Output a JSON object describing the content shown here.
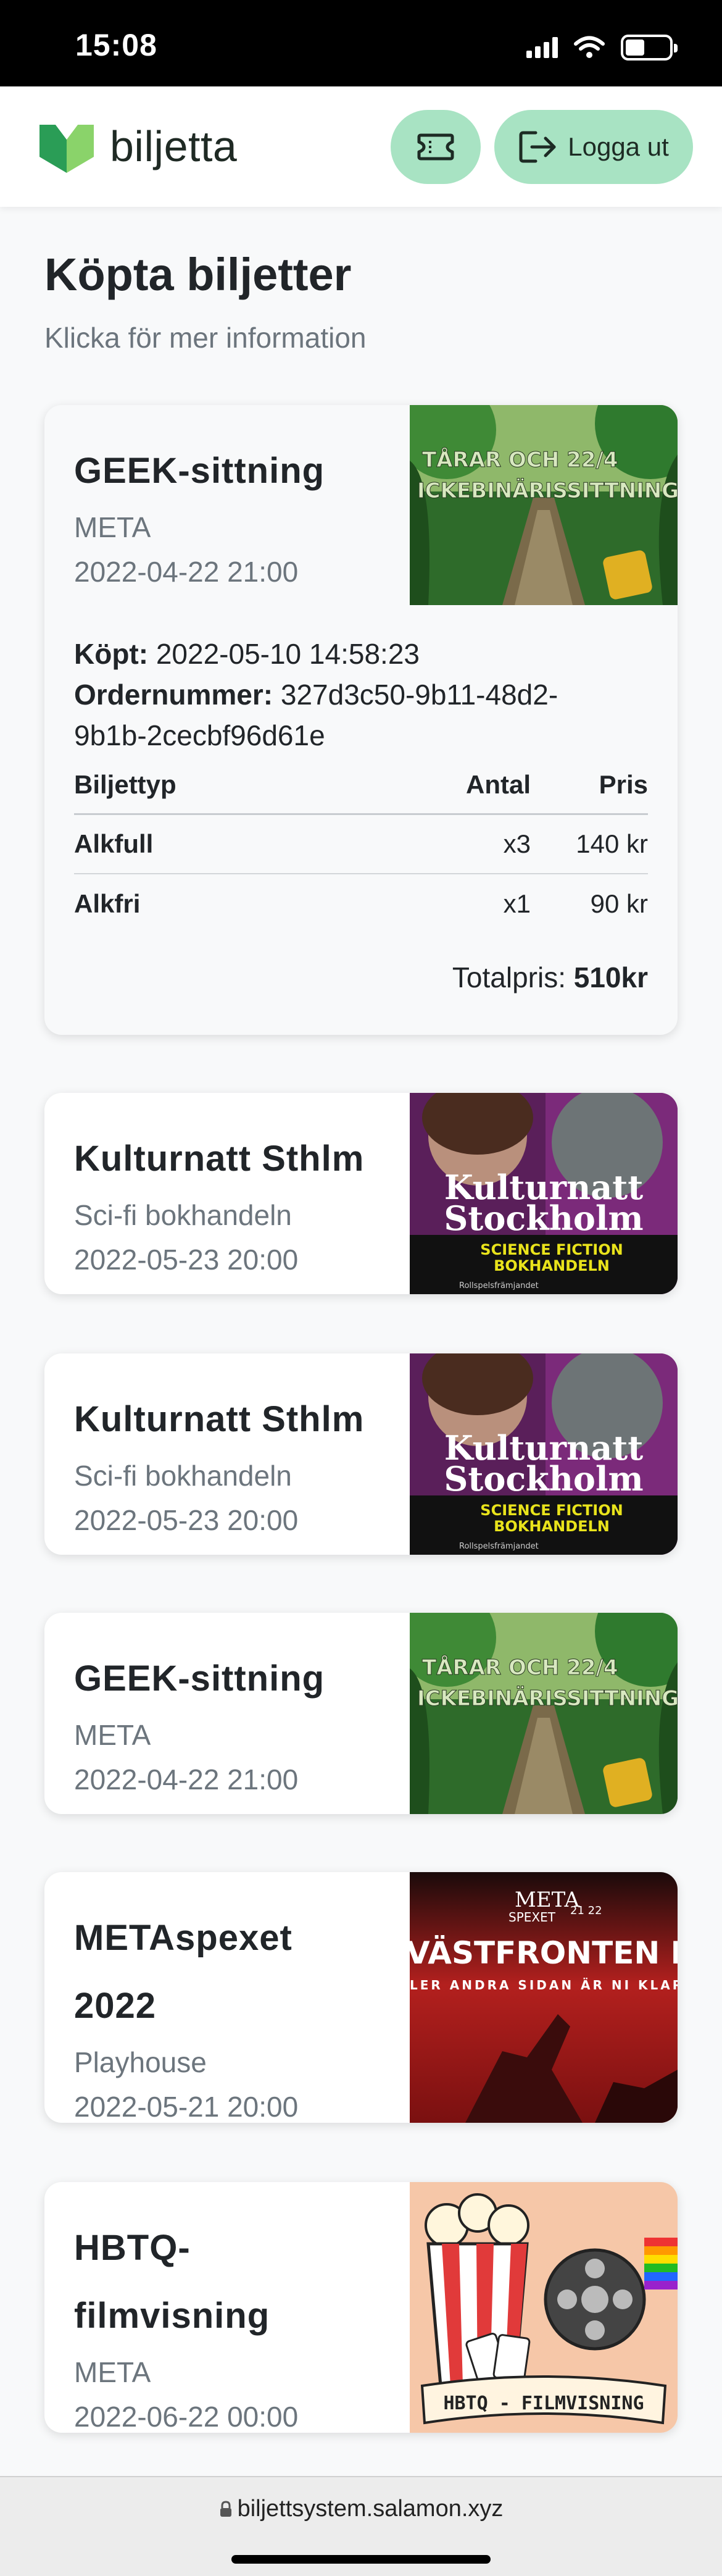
{
  "status_bar": {
    "time": "15:08"
  },
  "navbar": {
    "brand": "biljetta",
    "logout_label": "Logga ut",
    "colors": {
      "button_bg": "#a8e3c3",
      "logo_green_dark": "#2a9d56",
      "logo_green_light": "#8ad36a"
    }
  },
  "page": {
    "title": "Köpta biljetter",
    "subtitle": "Klicka för mer information"
  },
  "tickets": [
    {
      "name": "GEEK-sittning",
      "venue": "META",
      "date": "2022-04-22 21:00",
      "image": {
        "caption_top": "TÅRAR OCH 22/4",
        "caption_bottom": "ICKEBINÄRISSITTNING"
      },
      "expanded": true,
      "purchased_label": "Köpt:",
      "purchased": "2022-05-10 14:58:23",
      "order_label": "Ordernummer:",
      "order_line1": "327d3c50-9b11-48d2-",
      "order_line2": "9b1b-2cecbf96d61e",
      "columns": [
        "Biljettyp",
        "Antal",
        "Pris"
      ],
      "rows": [
        {
          "type": "Alkfull",
          "qty": "x3",
          "price": "140 kr"
        },
        {
          "type": "Alkfri",
          "qty": "x1",
          "price": "90 kr"
        }
      ],
      "total_label": "Totalpris:",
      "total": "510kr"
    },
    {
      "name": "Kulturnatt Sthlm",
      "venue": "Sci-fi bokhandeln",
      "date": "2022-05-23 20:00",
      "image": {
        "line1": "Kulturnatt",
        "line2": "Stockholm",
        "band1": "SCIENCE FICTION",
        "band2": "BOKHANDELN",
        "footer": "Rollspelsfrämjandet"
      }
    },
    {
      "name": "Kulturnatt Sthlm",
      "venue": "Sci-fi bokhandeln",
      "date": "2022-05-23 20:00",
      "image": {
        "line1": "Kulturnatt",
        "line2": "Stockholm",
        "band1": "SCIENCE FICTION",
        "band2": "BOKHANDELN",
        "footer": "Rollspelsfrämjandet"
      }
    },
    {
      "name": "GEEK-sittning",
      "venue": "META",
      "date": "2022-04-22 21:00",
      "image": {
        "caption_top": "TÅRAR OCH 22/4",
        "caption_bottom": "ICKEBINÄRISSITTNING"
      }
    },
    {
      "name_line1": "METAspexet",
      "name_line2": "2022",
      "venue": "Playhouse",
      "date": "2022-05-21 20:00",
      "image": {
        "brand": "META",
        "sub": "SPEXET",
        "year": "21 22",
        "title": "VÄSTFRONTEN INTET S",
        "tagline": "LER ANDRA SIDAN ÄR NI KLAR"
      }
    },
    {
      "name_line1": "HBTQ-",
      "name_line2": "filmvisning",
      "venue": "META",
      "date": "2022-06-22 00:00",
      "image": {
        "banner": "HBTQ - FILMVISNING"
      }
    }
  ],
  "browser": {
    "url": "biljettsystem.salamon.xyz"
  }
}
